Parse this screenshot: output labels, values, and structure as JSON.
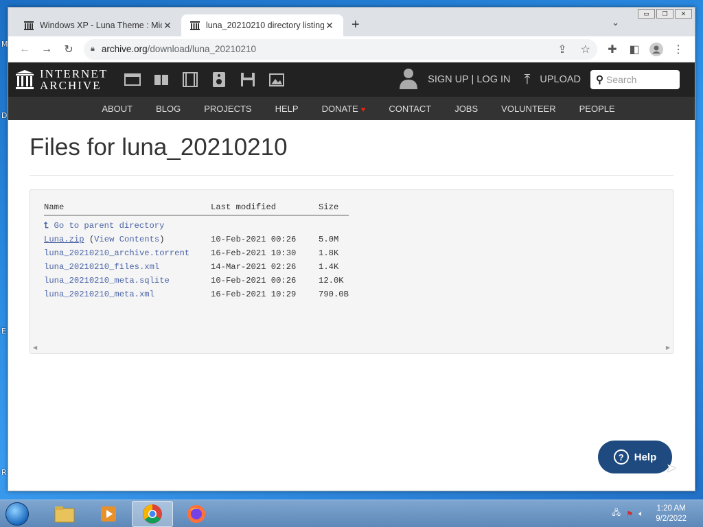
{
  "desktop": {
    "letters": [
      "M",
      "D",
      "E",
      "R"
    ]
  },
  "window_controls": {
    "minimize": "▭",
    "maximize": "❐",
    "close": "✕"
  },
  "tabs": [
    {
      "title": "Windows XP - Luna Theme : Mic",
      "close": "✕"
    },
    {
      "title": "luna_20210210 directory listing",
      "close": "✕"
    }
  ],
  "new_tab": "+",
  "tab_list": "⌄",
  "url": {
    "host": "archive.org",
    "path": "/download/luna_20210210"
  },
  "ia": {
    "logo_line1": "INTERNET",
    "logo_line2": "ARCHIVE",
    "signup": "SIGN UP | LOG IN",
    "upload": "UPLOAD",
    "search_placeholder": "Search",
    "nav": [
      "ABOUT",
      "BLOG",
      "PROJECTS",
      "HELP",
      "DONATE",
      "CONTACT",
      "JOBS",
      "VOLUNTEER",
      "PEOPLE"
    ]
  },
  "page": {
    "title": "Files for luna_20210210",
    "headers": {
      "name": "Name",
      "modified": "Last modified",
      "size": "Size"
    },
    "parent": "Go to parent directory",
    "files": [
      {
        "name": "Luna.zip",
        "extra": "View Contents",
        "modified": "10-Feb-2021 00:26",
        "size": "5.0M"
      },
      {
        "name": "luna_20210210_archive.torrent",
        "modified": "16-Feb-2021 10:30",
        "size": "1.8K"
      },
      {
        "name": "luna_20210210_files.xml",
        "modified": "14-Mar-2021 02:26",
        "size": "1.4K"
      },
      {
        "name": "luna_20210210_meta.sqlite",
        "modified": "10-Feb-2021 00:26",
        "size": "12.0K"
      },
      {
        "name": "luna_20210210_meta.xml",
        "modified": "16-Feb-2021 10:29",
        "size": "790.0B"
      }
    ]
  },
  "help": {
    "label": "Help",
    "symbol": "?"
  },
  "clock": {
    "time": "1:20 AM",
    "date": "9/2/2022"
  },
  "colors": {
    "ia_header": "#222222",
    "ia_nav": "#333333",
    "link": "#4b64a6",
    "help_bg": "#1e4a80"
  }
}
